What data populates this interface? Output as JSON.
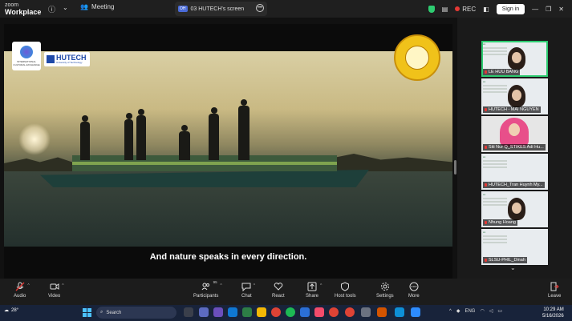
{
  "app": {
    "brand_line1": "zoom",
    "brand_line2": "Workplace",
    "meeting_label": "Meeting",
    "share_initials": "OH",
    "share_title": "03 HUTECH's screen",
    "rec_label": "REC",
    "signin_label": "Sign in"
  },
  "video": {
    "subtitle": "And nature speaks in every direction.",
    "logo_hutech": "HUTECH",
    "logo_hutech_sub": "University of Technology",
    "logo_left_text": "INTERNATIONAL CULTURAL EXCHANGE"
  },
  "participants": [
    {
      "name": "LE HUU BANG"
    },
    {
      "name": "HUTECH - MAI NGUYEN"
    },
    {
      "name": "Siti Nur Q_STIKES Adi Hu..."
    },
    {
      "name": "HUTECH_Tran Huynh My..."
    },
    {
      "name": "Nhung Hoang"
    },
    {
      "name": "SLSU-PHIL_Dinah"
    }
  ],
  "toolbar": {
    "audio": "Audio",
    "video": "Video",
    "participants": "Participants",
    "participants_count": "95",
    "chat": "Chat",
    "react": "React",
    "share": "Share",
    "host_tools": "Host tools",
    "settings": "Settings",
    "more": "More",
    "leave": "Leave"
  },
  "taskbar": {
    "temperature": "28°",
    "search_placeholder": "Search",
    "lang": "ENG",
    "time": "10:29 AM",
    "date": "5/16/2026"
  },
  "colors": {
    "accent_green": "#2ecc71",
    "rec_red": "#e53935",
    "hutech_blue": "#1f4aa8"
  }
}
